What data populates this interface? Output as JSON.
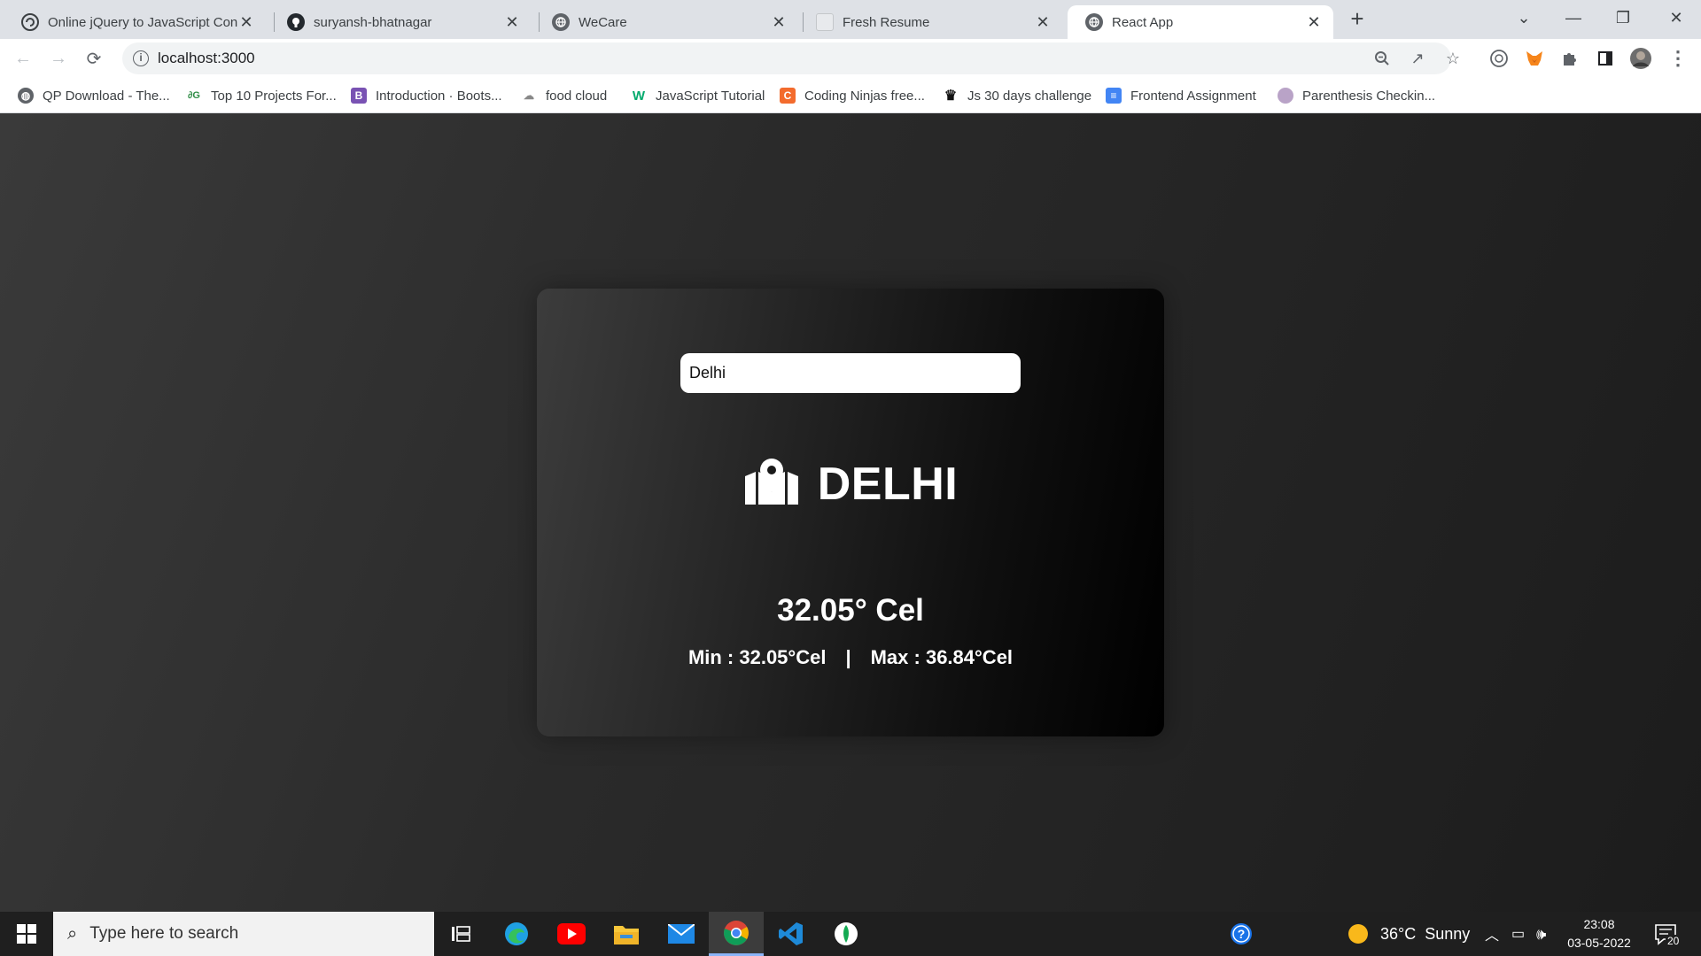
{
  "browser": {
    "tabs": [
      {
        "title": "Online jQuery to JavaScript Conv",
        "favicon": "converter-icon",
        "active": false
      },
      {
        "title": "suryansh-bhatnagar",
        "favicon": "github-icon",
        "active": false
      },
      {
        "title": "WeCare",
        "favicon": "globe-icon",
        "active": false
      },
      {
        "title": "Fresh Resume",
        "favicon": "page-icon",
        "active": false
      },
      {
        "title": "React App",
        "favicon": "globe-icon",
        "active": true
      }
    ],
    "url": "localhost:3000",
    "bookmarks": [
      {
        "label": "QP Download - The...",
        "icon": "globe-icon"
      },
      {
        "label": "Top 10 Projects For...",
        "icon": "gfg-icon"
      },
      {
        "label": "Introduction · Boots...",
        "icon": "bootstrap-icon"
      },
      {
        "label": "food cloud",
        "icon": "cloud-icon"
      },
      {
        "label": "JavaScript Tutorial",
        "icon": "w3schools-icon"
      },
      {
        "label": "Coding Ninjas free...",
        "icon": "codingninjas-icon"
      },
      {
        "label": "Js 30 days challenge",
        "icon": "crown-icon"
      },
      {
        "label": "Frontend Assignment",
        "icon": "docs-icon"
      },
      {
        "label": "Parenthesis Checkin...",
        "icon": "avatar-icon"
      }
    ]
  },
  "app": {
    "search_value": "Delhi",
    "city": "DELHI",
    "temperature": "32.05° Cel",
    "min_text": "Min : 32.05°Cel",
    "separator": "|",
    "max_text": "Max : 36.84°Cel",
    "city_icon": "map-pin-icon"
  },
  "taskbar": {
    "search_placeholder": "Type here to search",
    "weather": "36°C  Sunny",
    "time": "23:08",
    "date": "03-05-2022",
    "notification_count": "20"
  }
}
